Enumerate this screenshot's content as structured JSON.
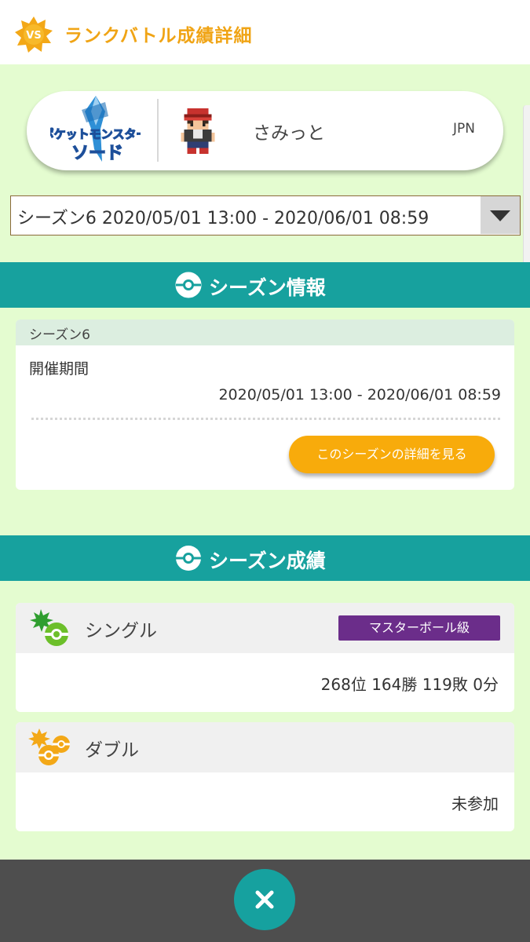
{
  "header": {
    "badge_text": "VS",
    "title": "ランクバトル成績詳細"
  },
  "trainer": {
    "game_logo_name": "pokemon-sword-logo",
    "logo_text_top": "ポケットモンスター",
    "logo_text_bottom": "ソード",
    "name": "さみっと",
    "region": "JPN"
  },
  "season_select": {
    "selected": "シーズン6 2020/05/01 13:00 - 2020/06/01 08:59"
  },
  "season_info": {
    "section_title": "シーズン情報",
    "card_title": "シーズン6",
    "period_label": "開催期間",
    "period_value": "2020/05/01 13:00 - 2020/06/01 08:59",
    "detail_button": "このシーズンの詳細を見る"
  },
  "season_results": {
    "section_title": "シーズン成績",
    "single": {
      "label": "シングル",
      "rank_badge": "マスターボール級",
      "result": "268位 164勝 119敗 0分"
    },
    "double": {
      "label": "ダブル",
      "result": "未参加"
    }
  },
  "colors": {
    "accent_orange": "#f0a415",
    "teal": "#17a19e",
    "light_green": "#e4fcd0",
    "master_ball_purple": "#6b2d8a",
    "button_orange": "#f8ab0b"
  },
  "icons": [
    "vs-badge-icon",
    "pokeball-icon",
    "single-battle-icon",
    "double-battle-icon",
    "close-icon",
    "dropdown-arrow-icon"
  ]
}
